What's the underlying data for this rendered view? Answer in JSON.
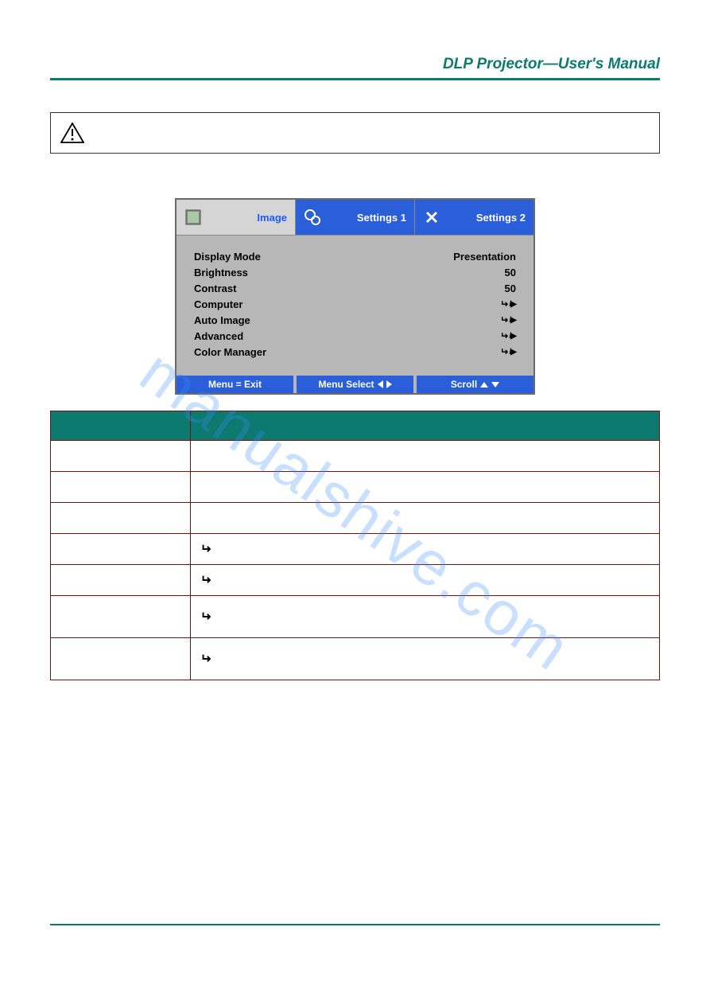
{
  "header": {
    "title": "DLP Projector—User's Manual"
  },
  "watermark": "manualshive.com",
  "osd": {
    "tabs": {
      "image": "Image",
      "settings1": "Settings 1",
      "settings2": "Settings 2"
    },
    "rows": [
      {
        "label": "Display Mode",
        "value": "Presentation"
      },
      {
        "label": "Brightness",
        "value": "50"
      },
      {
        "label": "Contrast",
        "value": "50"
      },
      {
        "label": "Computer",
        "value": "↵/▶"
      },
      {
        "label": "Auto Image",
        "value": "↵/▶"
      },
      {
        "label": "Advanced",
        "value": "↵/▶"
      },
      {
        "label": "Color Manager",
        "value": "↵/▶"
      }
    ],
    "footer": {
      "menu_exit": "Menu = Exit",
      "menu_select": "Menu Select",
      "scroll": "Scroll"
    }
  },
  "table": {
    "head_item": "",
    "head_desc": "",
    "rows": [
      {
        "item": "",
        "desc": "",
        "tall": false,
        "has_icon": false
      },
      {
        "item": "",
        "desc": "",
        "tall": false,
        "has_icon": false
      },
      {
        "item": "",
        "desc": "",
        "tall": false,
        "has_icon": false
      },
      {
        "item": "",
        "desc": "",
        "tall": false,
        "has_icon": true
      },
      {
        "item": "",
        "desc": "",
        "tall": false,
        "has_icon": true
      },
      {
        "item": "",
        "desc": "",
        "tall": true,
        "has_icon": true
      },
      {
        "item": "",
        "desc": "",
        "tall": true,
        "has_icon": true
      }
    ]
  }
}
